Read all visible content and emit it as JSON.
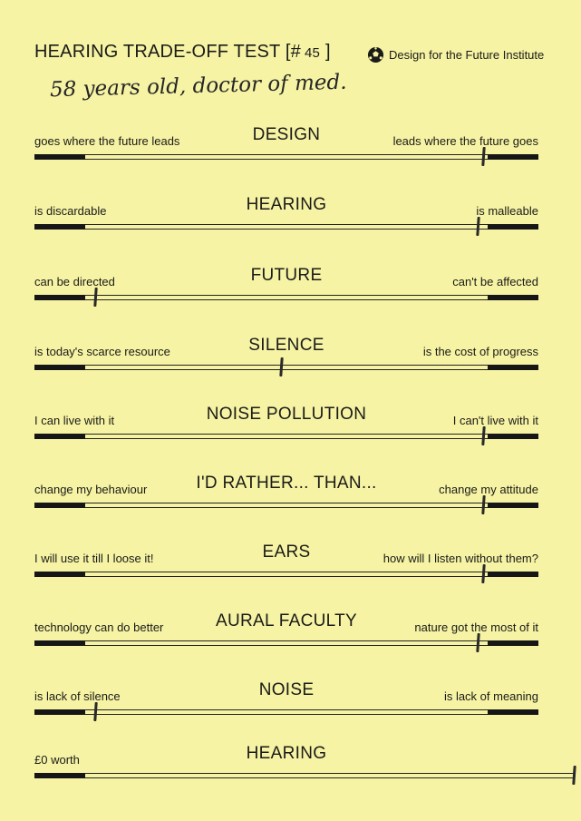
{
  "header": {
    "title": "HEARING TRADE-OFF TEST [#",
    "number": "45",
    "title_close": "]",
    "brand": "Design for the Future Institute",
    "brand_icon": "soccer-ball-icon"
  },
  "respondent_note": "58 years old, doctor of med.",
  "scales": [
    {
      "heading": "DESIGN",
      "left": "goes where the future leads",
      "right": "leads where the future goes",
      "mark": 0.89
    },
    {
      "heading": "HEARING",
      "left": "is discardable",
      "right": "is malleable",
      "mark": 0.88
    },
    {
      "heading": "FUTURE",
      "left": "can be directed",
      "right": "can't be affected",
      "mark": 0.12
    },
    {
      "heading": "SILENCE",
      "left": "is today's scarce resource",
      "right": "is the cost of progress",
      "mark": 0.49
    },
    {
      "heading": "NOISE POLLUTION",
      "left": "I can live with it",
      "right": "I can't live with it",
      "mark": 0.89
    },
    {
      "heading": "I'D RATHER... THAN...",
      "left": "change my behaviour",
      "right": "change my attitude",
      "mark": 0.89
    },
    {
      "heading": "EARS",
      "left": "I will use it till I loose it!",
      "right": "how will I listen without them?",
      "mark": 0.89
    },
    {
      "heading": "AURAL FACULTY",
      "left": "technology can do better",
      "right": "nature got the most of it",
      "mark": 0.88
    },
    {
      "heading": "NOISE",
      "left": "is lack of silence",
      "right": "is lack of meaning",
      "mark": 0.12
    },
    {
      "heading": "HEARING",
      "left": "£0 worth",
      "right": "",
      "mark": 1.07
    }
  ]
}
